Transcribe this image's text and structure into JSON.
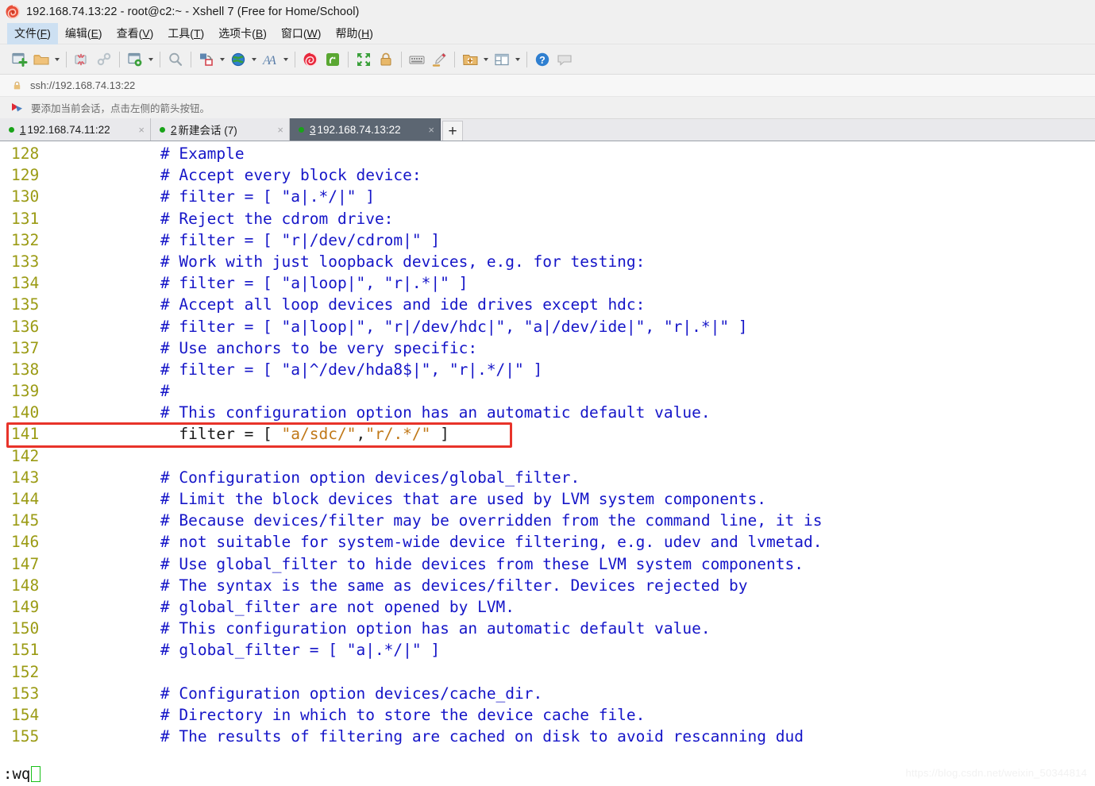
{
  "window": {
    "title": "192.168.74.13:22 - root@c2:~ - Xshell 7 (Free for Home/School)",
    "app_icon": "xshell-shell-icon"
  },
  "menubar": {
    "items": [
      {
        "label": "文件(F)",
        "text": "文件(",
        "accel": "F",
        "tail": ")",
        "active": true
      },
      {
        "label": "编辑(E)",
        "text": "编辑(",
        "accel": "E",
        "tail": ")",
        "active": false
      },
      {
        "label": "查看(V)",
        "text": "查看(",
        "accel": "V",
        "tail": ")",
        "active": false
      },
      {
        "label": "工具(T)",
        "text": "工具(",
        "accel": "T",
        "tail": ")",
        "active": false
      },
      {
        "label": "选项卡(B)",
        "text": "选项卡(",
        "accel": "B",
        "tail": ")",
        "active": false
      },
      {
        "label": "窗口(W)",
        "text": "窗口(",
        "accel": "W",
        "tail": ")",
        "active": false
      },
      {
        "label": "帮助(H)",
        "text": "帮助(",
        "accel": "H",
        "tail": ")",
        "active": false
      }
    ]
  },
  "toolbar": {
    "buttons": [
      {
        "name": "new-session-icon",
        "kind": "icon"
      },
      {
        "name": "open-folder-icon",
        "kind": "icon"
      },
      {
        "name": "open-folder-dropdown",
        "kind": "caret"
      },
      {
        "name": "separator-1",
        "kind": "sep"
      },
      {
        "name": "disconnect-icon",
        "kind": "icon"
      },
      {
        "name": "reconnect-icon",
        "kind": "icon"
      },
      {
        "name": "separator-2",
        "kind": "sep"
      },
      {
        "name": "session-properties-icon",
        "kind": "icon"
      },
      {
        "name": "session-properties-dropdown",
        "kind": "caret"
      },
      {
        "name": "separator-3",
        "kind": "sep"
      },
      {
        "name": "find-icon",
        "kind": "icon"
      },
      {
        "name": "separator-4",
        "kind": "sep"
      },
      {
        "name": "file-transfer-icon",
        "kind": "icon"
      },
      {
        "name": "file-transfer-dropdown",
        "kind": "caret"
      },
      {
        "name": "globe-icon",
        "kind": "icon"
      },
      {
        "name": "globe-dropdown",
        "kind": "caret"
      },
      {
        "name": "font-icon",
        "kind": "icon"
      },
      {
        "name": "font-dropdown",
        "kind": "caret"
      },
      {
        "name": "separator-5",
        "kind": "sep"
      },
      {
        "name": "xshell-icon",
        "kind": "icon"
      },
      {
        "name": "xftp-icon",
        "kind": "icon"
      },
      {
        "name": "separator-6",
        "kind": "sep"
      },
      {
        "name": "fullscreen-icon",
        "kind": "icon"
      },
      {
        "name": "lock-icon",
        "kind": "icon"
      },
      {
        "name": "separator-7",
        "kind": "sep"
      },
      {
        "name": "keyboard-icon",
        "kind": "icon"
      },
      {
        "name": "highlight-pen-icon",
        "kind": "icon"
      },
      {
        "name": "separator-8",
        "kind": "sep"
      },
      {
        "name": "add-panel-icon",
        "kind": "icon"
      },
      {
        "name": "add-panel-dropdown",
        "kind": "caret"
      },
      {
        "name": "layout-icon",
        "kind": "icon"
      },
      {
        "name": "layout-dropdown",
        "kind": "caret"
      },
      {
        "name": "separator-9",
        "kind": "sep"
      },
      {
        "name": "help-icon",
        "kind": "icon"
      },
      {
        "name": "chat-icon",
        "kind": "icon"
      }
    ]
  },
  "address_bar": {
    "icon": "lock-icon",
    "value": "ssh://192.168.74.13:22"
  },
  "notice_bar": {
    "icon": "red-arrow-flag-icon",
    "text": "要添加当前会话，点击左侧的箭头按钮。"
  },
  "tabs": {
    "items": [
      {
        "num": "1",
        "label": "192.168.74.11:22",
        "active": false,
        "close": "×",
        "dot_color": "#19a319"
      },
      {
        "num": "2",
        "label": "新建会话 (7)",
        "active": false,
        "close": "×",
        "dot_color": "#19a319"
      },
      {
        "num": "3",
        "label": "192.168.74.13:22",
        "active": true,
        "close": "×",
        "dot_color": "#19a319"
      }
    ],
    "add_label": "+"
  },
  "terminal": {
    "colors": {
      "background": "#ffffff",
      "line_number": "#9b9b14",
      "comment": "#1515c8",
      "plain": "#1a1a1a",
      "string": "#c07818",
      "highlight_box": "#e8332a",
      "cursor": "#18c018"
    },
    "lines": [
      {
        "no": "128",
        "highlight": false,
        "segments": [
          {
            "t": "        # Example",
            "c": "comment"
          }
        ]
      },
      {
        "no": "129",
        "highlight": false,
        "segments": [
          {
            "t": "        # Accept every block device:",
            "c": "comment"
          }
        ]
      },
      {
        "no": "130",
        "highlight": false,
        "segments": [
          {
            "t": "        # filter = [ \"a|.*/|\" ]",
            "c": "comment"
          }
        ]
      },
      {
        "no": "131",
        "highlight": false,
        "segments": [
          {
            "t": "        # Reject the cdrom drive:",
            "c": "comment"
          }
        ]
      },
      {
        "no": "132",
        "highlight": false,
        "segments": [
          {
            "t": "        # filter = [ \"r|/dev/cdrom|\" ]",
            "c": "comment"
          }
        ]
      },
      {
        "no": "133",
        "highlight": false,
        "segments": [
          {
            "t": "        # Work with just loopback devices, e.g. for testing:",
            "c": "comment"
          }
        ]
      },
      {
        "no": "134",
        "highlight": false,
        "segments": [
          {
            "t": "        # filter = [ \"a|loop|\", \"r|.*|\" ]",
            "c": "comment"
          }
        ]
      },
      {
        "no": "135",
        "highlight": false,
        "segments": [
          {
            "t": "        # Accept all loop devices and ide drives except hdc:",
            "c": "comment"
          }
        ]
      },
      {
        "no": "136",
        "highlight": false,
        "segments": [
          {
            "t": "        # filter = [ \"a|loop|\", \"r|/dev/hdc|\", \"a|/dev/ide|\", \"r|.*|\" ]",
            "c": "comment"
          }
        ]
      },
      {
        "no": "137",
        "highlight": false,
        "segments": [
          {
            "t": "        # Use anchors to be very specific:",
            "c": "comment"
          }
        ]
      },
      {
        "no": "138",
        "highlight": false,
        "segments": [
          {
            "t": "        # filter = [ \"a|^/dev/hda8$|\", \"r|.*/|\" ]",
            "c": "comment"
          }
        ]
      },
      {
        "no": "139",
        "highlight": false,
        "segments": [
          {
            "t": "        #",
            "c": "comment"
          }
        ]
      },
      {
        "no": "140",
        "highlight": false,
        "segments": [
          {
            "t": "        # This configuration option has an automatic default value.",
            "c": "comment"
          }
        ]
      },
      {
        "no": "141",
        "highlight": true,
        "segments": [
          {
            "t": "          filter = [ ",
            "c": "plain"
          },
          {
            "t": "\"a/sdc/\"",
            "c": "string"
          },
          {
            "t": ",",
            "c": "plain"
          },
          {
            "t": "\"r/.*/\"",
            "c": "string"
          },
          {
            "t": " ]",
            "c": "plain"
          }
        ]
      },
      {
        "no": "142",
        "highlight": false,
        "segments": [
          {
            "t": "",
            "c": "plain"
          }
        ]
      },
      {
        "no": "143",
        "highlight": false,
        "segments": [
          {
            "t": "        # Configuration option devices/global_filter.",
            "c": "comment"
          }
        ]
      },
      {
        "no": "144",
        "highlight": false,
        "segments": [
          {
            "t": "        # Limit the block devices that are used by LVM system components.",
            "c": "comment"
          }
        ]
      },
      {
        "no": "145",
        "highlight": false,
        "segments": [
          {
            "t": "        # Because devices/filter may be overridden from the command line, it is",
            "c": "comment"
          }
        ]
      },
      {
        "no": "146",
        "highlight": false,
        "segments": [
          {
            "t": "        # not suitable for system-wide device filtering, e.g. udev and lvmetad.",
            "c": "comment"
          }
        ]
      },
      {
        "no": "147",
        "highlight": false,
        "segments": [
          {
            "t": "        # Use global_filter to hide devices from these LVM system components.",
            "c": "comment"
          }
        ]
      },
      {
        "no": "148",
        "highlight": false,
        "segments": [
          {
            "t": "        # The syntax is the same as devices/filter. Devices rejected by",
            "c": "comment"
          }
        ]
      },
      {
        "no": "149",
        "highlight": false,
        "segments": [
          {
            "t": "        # global_filter are not opened by LVM.",
            "c": "comment"
          }
        ]
      },
      {
        "no": "150",
        "highlight": false,
        "segments": [
          {
            "t": "        # This configuration option has an automatic default value.",
            "c": "comment"
          }
        ]
      },
      {
        "no": "151",
        "highlight": false,
        "segments": [
          {
            "t": "        # global_filter = [ \"a|.*/|\" ]",
            "c": "comment"
          }
        ]
      },
      {
        "no": "152",
        "highlight": false,
        "segments": [
          {
            "t": "",
            "c": "plain"
          }
        ]
      },
      {
        "no": "153",
        "highlight": false,
        "segments": [
          {
            "t": "        # Configuration option devices/cache_dir.",
            "c": "comment"
          }
        ]
      },
      {
        "no": "154",
        "highlight": false,
        "segments": [
          {
            "t": "        # Directory in which to store the device cache file.",
            "c": "comment"
          }
        ]
      },
      {
        "no": "155",
        "highlight": false,
        "segments": [
          {
            "t": "        # The results of filtering are cached on disk to avoid rescanning dud",
            "c": "comment"
          }
        ]
      }
    ]
  },
  "statusbar": {
    "command": ":wq",
    "watermark": "https://blog.csdn.net/weixin_50344814"
  }
}
